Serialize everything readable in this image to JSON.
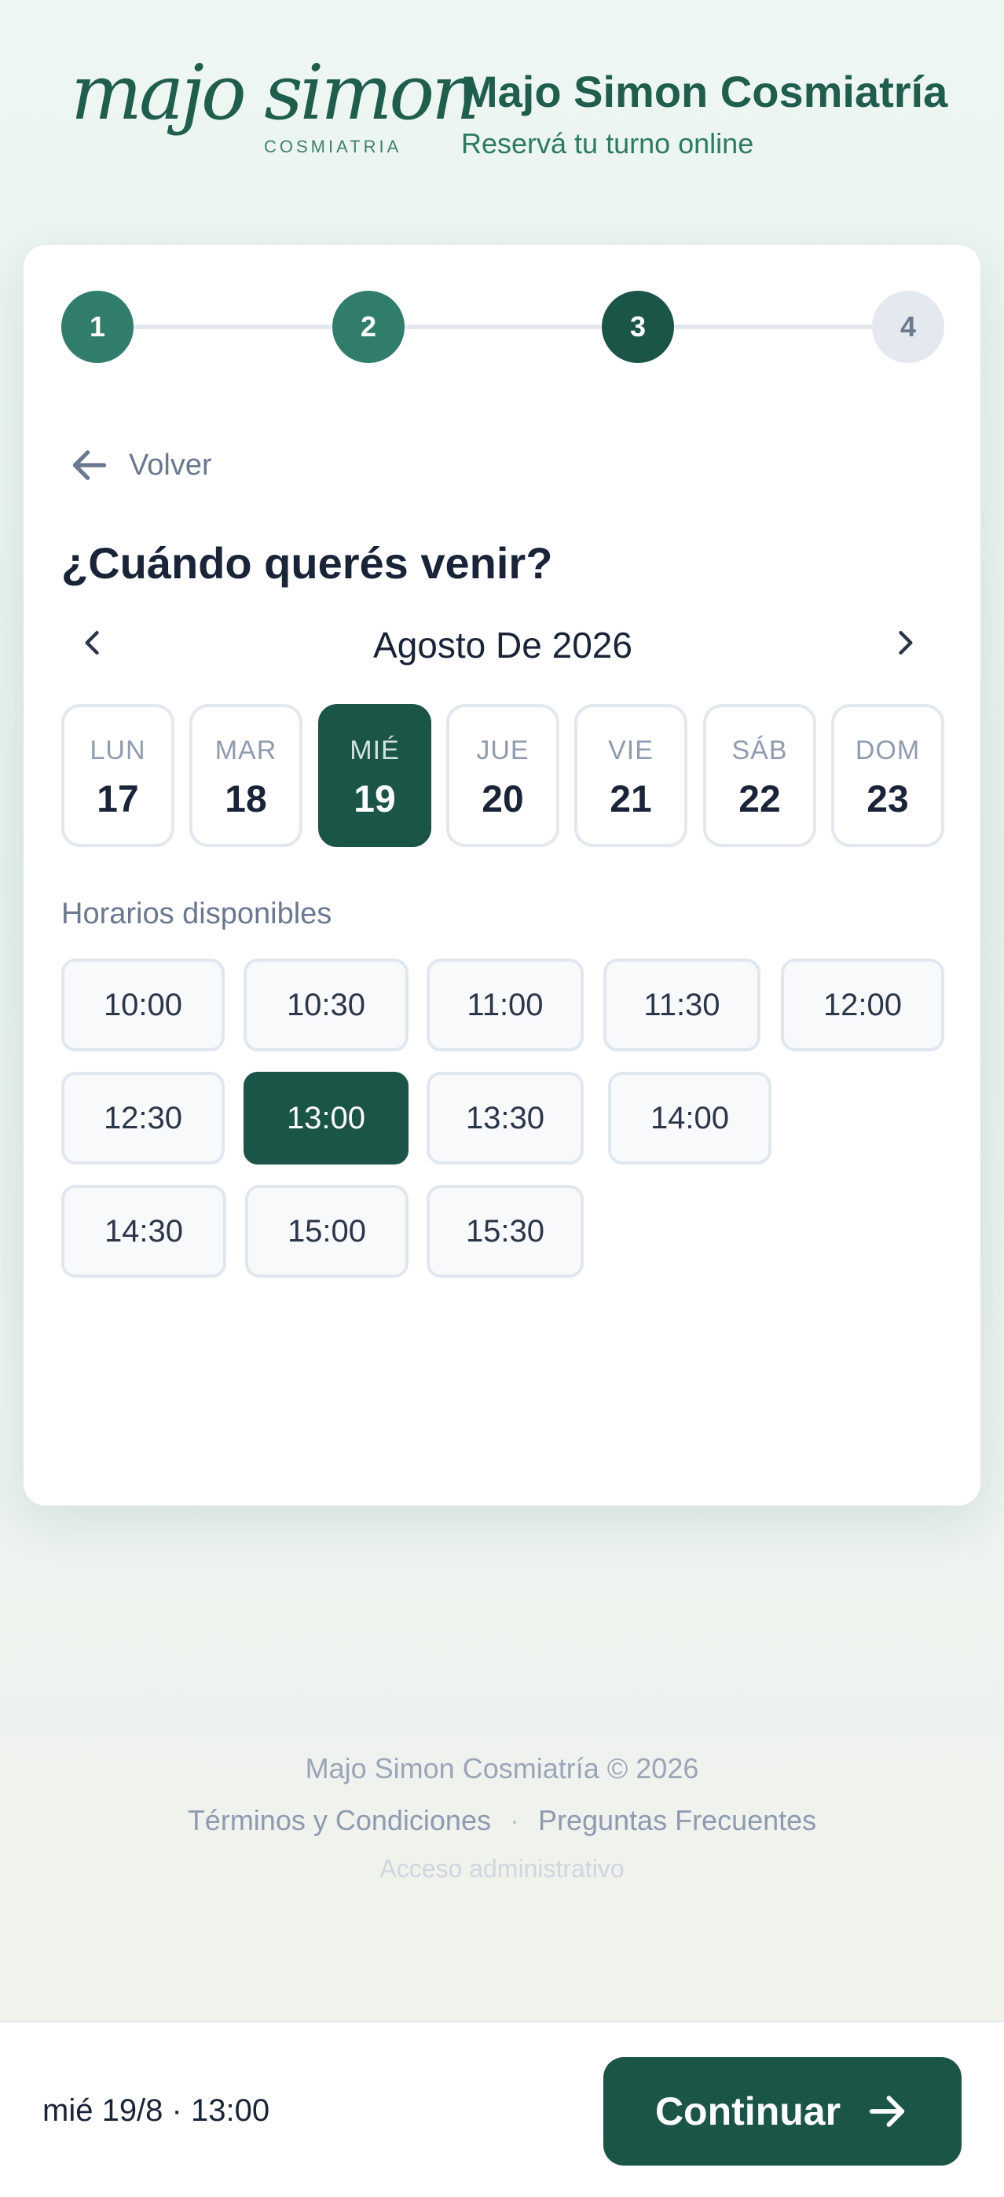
{
  "header": {
    "logo_script": "majo simon",
    "logo_sub": "COSMIATRIA",
    "title": "Majo Simon Cosmiatría",
    "subtitle": "Reservá tu turno online"
  },
  "stepper": {
    "steps": [
      "1",
      "2",
      "3",
      "4"
    ],
    "current_step": 3
  },
  "booking": {
    "back_label": "Volver",
    "question": "¿Cuándo querés venir?",
    "month_label": "Agosto De 2026",
    "days": [
      {
        "name": "LUN",
        "num": "17"
      },
      {
        "name": "MAR",
        "num": "18"
      },
      {
        "name": "MIÉ",
        "num": "19"
      },
      {
        "name": "JUE",
        "num": "20"
      },
      {
        "name": "VIE",
        "num": "21"
      },
      {
        "name": "SÁB",
        "num": "22"
      },
      {
        "name": "DOM",
        "num": "23"
      }
    ],
    "selected_day": "19",
    "slots_title": "Horarios disponibles",
    "slots": [
      "10:00",
      "10:30",
      "11:00",
      "11:30",
      "12:00",
      "12:30",
      "13:00",
      "13:30",
      "14:00",
      "14:30",
      "15:00",
      "15:30"
    ],
    "selected_slot": "13:00"
  },
  "footer": {
    "copyright": "Majo Simon Cosmiatría © 2026",
    "terms": "Términos y Condiciones",
    "separator": "·",
    "faq": "Preguntas Frecuentes",
    "admin": "Acceso administrativo"
  },
  "bottom_bar": {
    "summary": "mié 19/8 · 13:00",
    "continue_label": "Continuar"
  },
  "colors": {
    "primary": "#1b5548",
    "step_done": "#2f7d6a",
    "brand_text": "#1f5d4d"
  },
  "icons": {
    "back": "arrow-left-icon",
    "prev_month": "chevron-left-icon",
    "next_month": "chevron-right-icon",
    "continue": "arrow-right-icon"
  }
}
